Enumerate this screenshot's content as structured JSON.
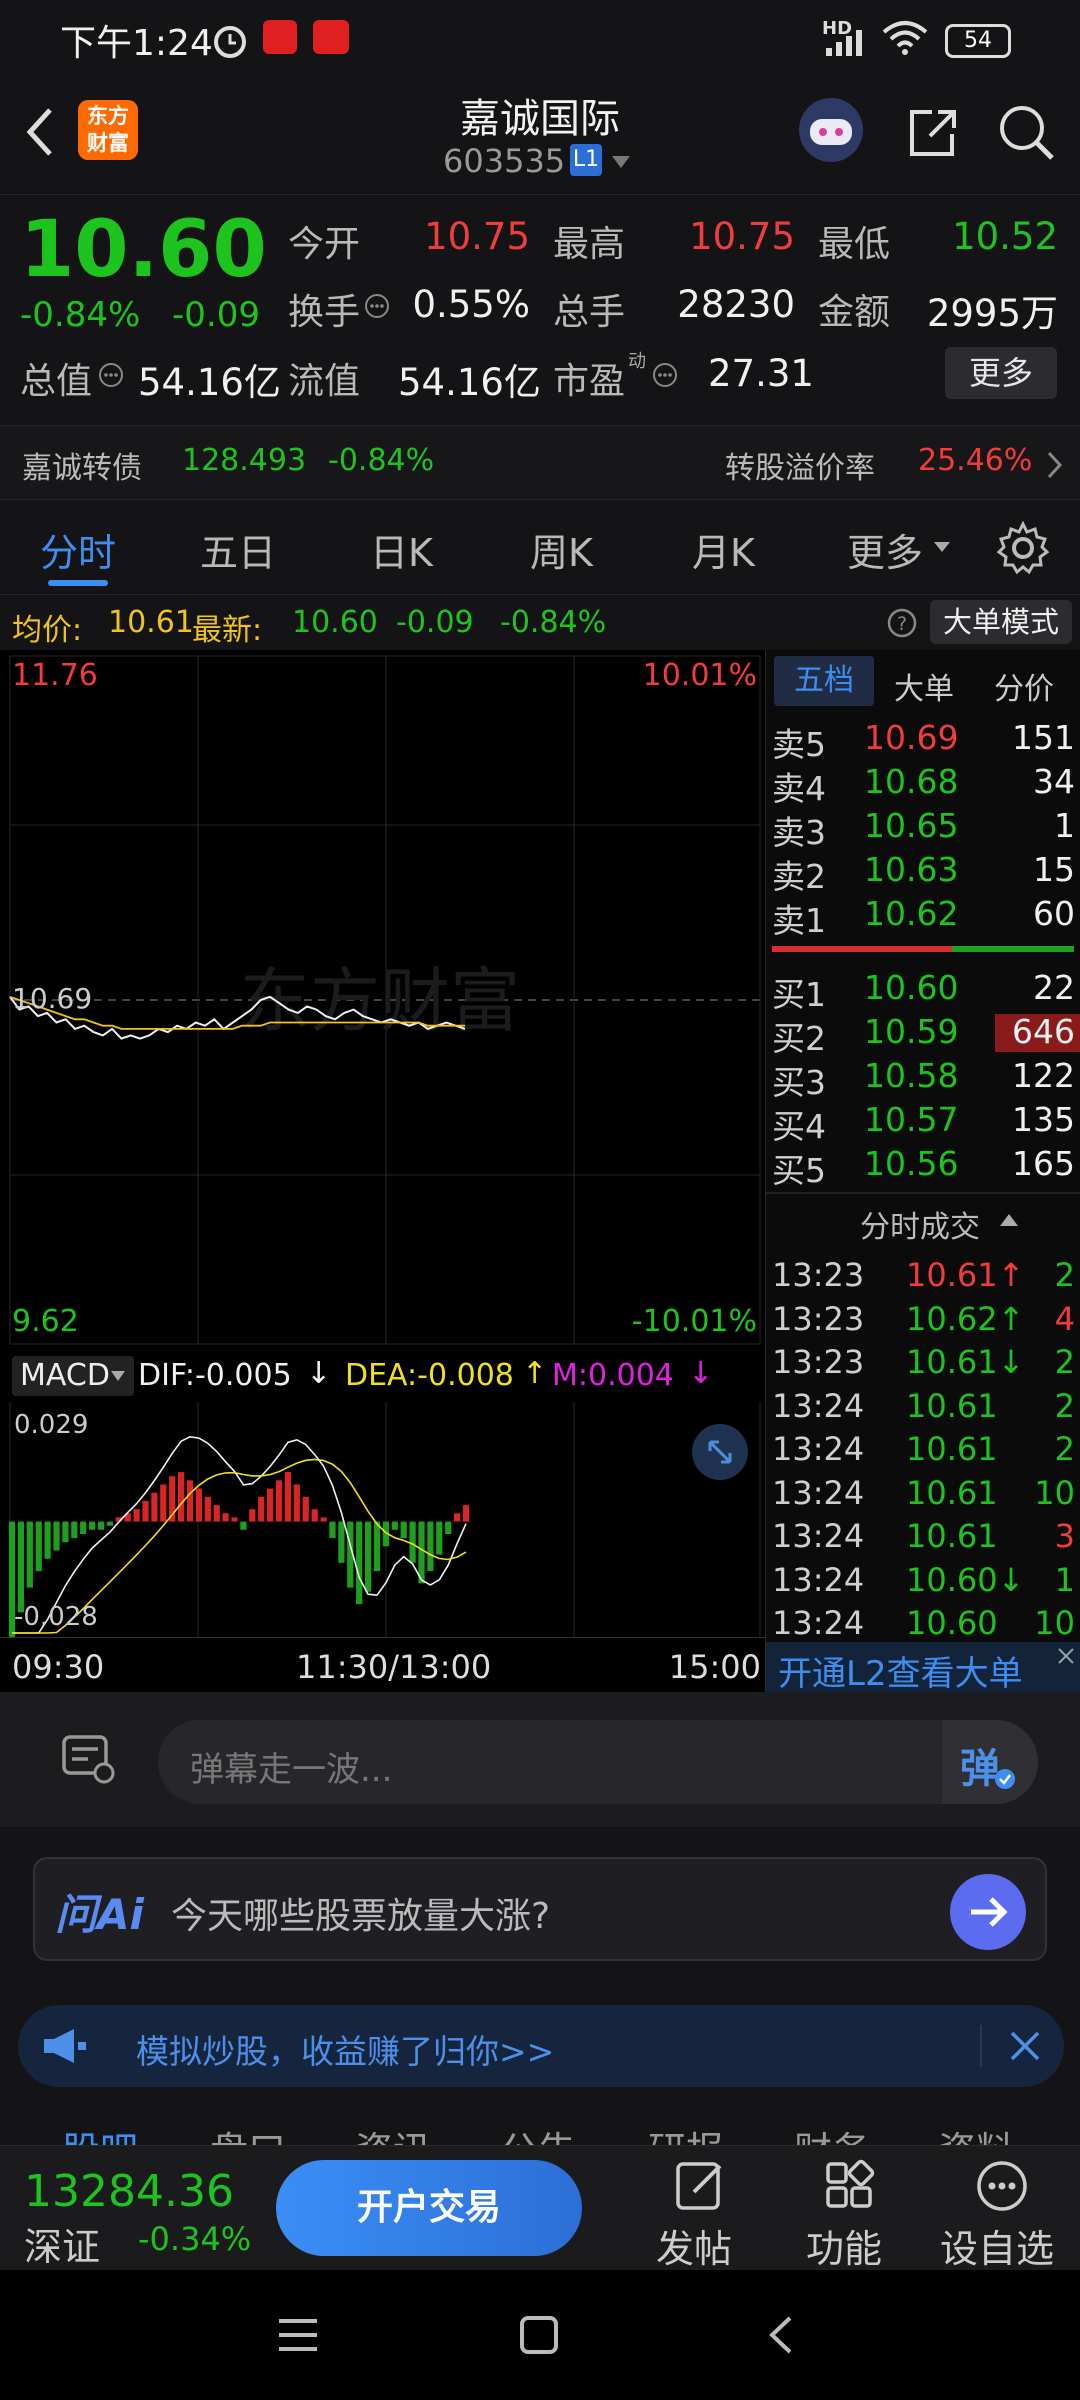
{
  "status_bar": {
    "time": "下午1:24",
    "hd": "HD",
    "battery": "54"
  },
  "header": {
    "title": "嘉诚国际",
    "code": "603535",
    "level": "L1",
    "logo_line1": "东方",
    "logo_line2": "财富"
  },
  "quote": {
    "price": "10.60",
    "change_pct": "-0.84%",
    "change": "-0.09",
    "open_label": "今开",
    "open": "10.75",
    "high_label": "最高",
    "high": "10.75",
    "low_label": "最低",
    "low": "10.52",
    "turnover_label": "换手",
    "turnover": "0.55%",
    "volume_label": "总手",
    "volume": "28230",
    "amount_label": "金额",
    "amount": "2995万",
    "total_cap_label": "总值",
    "total_cap": "54.16亿",
    "float_cap_label": "流值",
    "float_cap": "54.16亿",
    "pe_label": "市盈",
    "pe_sup": "动",
    "pe": "27.31",
    "more_button": "更多"
  },
  "bond": {
    "name": "嘉诚转债",
    "price": "128.493",
    "change": "-0.84%",
    "premium_label": "转股溢价率",
    "premium": "25.46%"
  },
  "tabs": [
    "分时",
    "五日",
    "日K",
    "周K",
    "月K",
    "更多"
  ],
  "avg_row": {
    "avg_label": "均价:",
    "avg": "10.61",
    "latest_label": "最新:",
    "latest": "10.60",
    "chg": "-0.09",
    "chg_pct": "-0.84%",
    "big_order_mode": "大单模式"
  },
  "chart_data": {
    "type": "line",
    "price_axis": {
      "top": "11.76",
      "bottom": "9.62",
      "ref": "10.69",
      "top_pct": "10.01%",
      "bottom_pct": "-10.01%"
    },
    "ylim": [
      9.62,
      11.76
    ],
    "prev_close": 10.69,
    "series": [
      {
        "values": [
          10.7,
          10.66,
          10.67,
          10.64,
          10.65,
          10.62,
          10.63,
          10.6,
          10.61,
          10.59,
          10.58,
          10.6,
          10.57,
          10.58,
          10.57,
          10.58,
          10.6,
          10.59,
          10.61,
          10.6,
          10.62,
          10.61,
          10.63,
          10.6,
          10.62,
          10.64,
          10.66,
          10.69,
          10.7,
          10.68,
          10.66,
          10.65,
          10.67,
          10.66,
          10.64,
          10.63,
          10.65,
          10.66,
          10.64,
          10.63,
          10.62,
          10.63,
          10.62,
          10.61,
          10.62,
          10.6,
          10.61,
          10.62,
          10.61,
          10.6
        ]
      },
      {
        "values": [
          10.7,
          10.69,
          10.68,
          10.67,
          10.66,
          10.65,
          10.64,
          10.63,
          10.63,
          10.62,
          10.61,
          10.61,
          10.6,
          10.6,
          10.6,
          10.6,
          10.6,
          10.6,
          10.6,
          10.6,
          10.6,
          10.6,
          10.6,
          10.6,
          10.6,
          10.61,
          10.61,
          10.61,
          10.62,
          10.62,
          10.62,
          10.62,
          10.62,
          10.62,
          10.62,
          10.62,
          10.62,
          10.62,
          10.62,
          10.62,
          10.62,
          10.62,
          10.62,
          10.62,
          10.62,
          10.61,
          10.61,
          10.61,
          10.61,
          10.61
        ]
      }
    ],
    "time_labels": [
      "09:30",
      "11:30/13:00",
      "15:00"
    ],
    "watermark": "东方财富"
  },
  "macd": {
    "selector": "MACD",
    "dif": "DIF:-0.005",
    "dea": "DEA:-0.008",
    "m": "M:0.004",
    "top": "0.029",
    "bottom": "-0.028",
    "hist": [
      -0.028,
      -0.022,
      -0.016,
      -0.012,
      -0.009,
      -0.007,
      -0.005,
      -0.004,
      -0.003,
      -0.002,
      -0.002,
      -0.001,
      0.001,
      0.002,
      0.003,
      0.005,
      0.007,
      0.009,
      0.011,
      0.012,
      0.01,
      0.008,
      0.006,
      0.004,
      0.002,
      0.001,
      -0.002,
      0.003,
      0.006,
      0.008,
      0.01,
      0.012,
      0.009,
      0.006,
      0.003,
      0.001,
      -0.004,
      -0.01,
      -0.016,
      -0.02,
      -0.017,
      -0.012,
      -0.006,
      -0.002,
      -0.004,
      -0.01,
      -0.015,
      -0.012,
      -0.008,
      -0.003,
      0.002,
      0.004
    ]
  },
  "book": {
    "tabs": [
      "五档",
      "大单",
      "分价"
    ],
    "sells": [
      {
        "label": "卖5",
        "price": "10.69",
        "vol": "151"
      },
      {
        "label": "卖4",
        "price": "10.68",
        "vol": "34"
      },
      {
        "label": "卖3",
        "price": "10.65",
        "vol": "1"
      },
      {
        "label": "卖2",
        "price": "10.63",
        "vol": "15"
      },
      {
        "label": "卖1",
        "price": "10.62",
        "vol": "60"
      }
    ],
    "buys": [
      {
        "label": "买1",
        "price": "10.60",
        "vol": "22"
      },
      {
        "label": "买2",
        "price": "10.59",
        "vol": "646"
      },
      {
        "label": "买3",
        "price": "10.58",
        "vol": "122"
      },
      {
        "label": "买4",
        "price": "10.57",
        "vol": "135"
      },
      {
        "label": "买5",
        "price": "10.56",
        "vol": "165"
      }
    ],
    "trades_title": "分时成交",
    "trades": [
      {
        "time": "13:23",
        "price": "10.61↑",
        "vol": "2",
        "pc": "red",
        "vc": "green"
      },
      {
        "time": "13:23",
        "price": "10.62↑",
        "vol": "4",
        "pc": "green",
        "vc": "red"
      },
      {
        "time": "13:23",
        "price": "10.61↓",
        "vol": "2",
        "pc": "green",
        "vc": "green"
      },
      {
        "time": "13:24",
        "price": "10.61",
        "vol": "2",
        "pc": "green",
        "vc": "green"
      },
      {
        "time": "13:24",
        "price": "10.61",
        "vol": "2",
        "pc": "green",
        "vc": "green"
      },
      {
        "time": "13:24",
        "price": "10.61",
        "vol": "10",
        "pc": "green",
        "vc": "green"
      },
      {
        "time": "13:24",
        "price": "10.61",
        "vol": "3",
        "pc": "green",
        "vc": "red"
      },
      {
        "time": "13:24",
        "price": "10.60↓",
        "vol": "1",
        "pc": "green",
        "vc": "green"
      },
      {
        "time": "13:24",
        "price": "10.60",
        "vol": "10",
        "pc": "green",
        "vc": "green"
      }
    ],
    "l2_link": "开通L2查看大单"
  },
  "danmu": {
    "placeholder": "弹幕走一波...",
    "button": "弹"
  },
  "ai": {
    "brand": "问Ai",
    "prompt": "今天哪些股票放量大涨?"
  },
  "promo": {
    "text": "模拟炒股，收益赚了归你>>"
  },
  "subtabs": [
    "股吧",
    "盘口",
    "资讯",
    "公告",
    "研报",
    "财务",
    "资料"
  ],
  "bottom": {
    "index_value": "13284.36",
    "index_name": "深证",
    "index_change": "-0.34%",
    "trade_button": "开户交易",
    "post": "发帖",
    "features": "功能",
    "watchlist": "设自选"
  },
  "colors": {
    "up": "#f23c3c",
    "down": "#1ec41e",
    "accent": "#3d8ef0",
    "bg": "#141416"
  }
}
